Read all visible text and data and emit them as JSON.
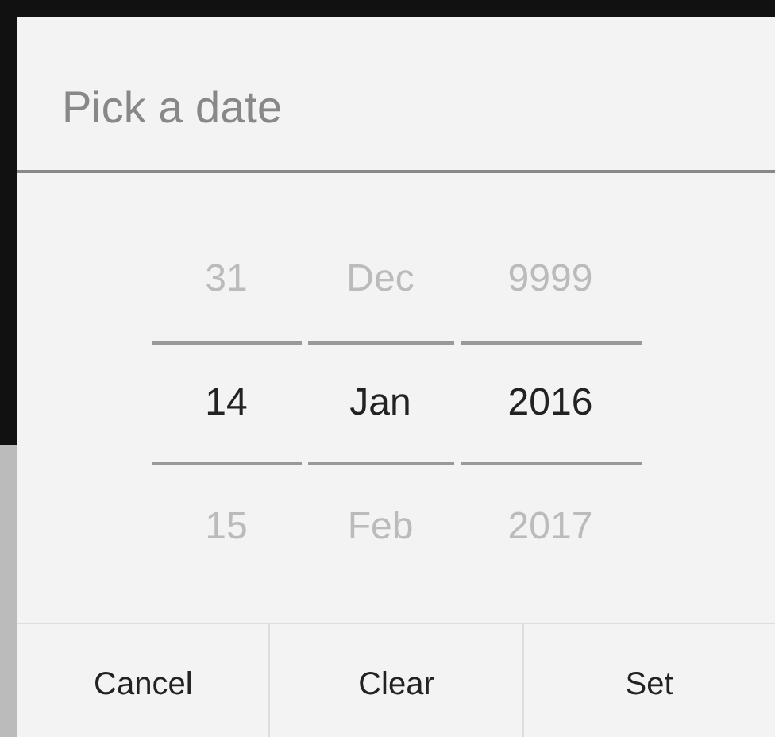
{
  "dialog": {
    "title": "Pick a date",
    "pickers": [
      {
        "items": [
          {
            "label": "31",
            "selected": false
          },
          {
            "label": "14",
            "selected": true
          },
          {
            "label": "15",
            "selected": false
          }
        ]
      },
      {
        "items": [
          {
            "label": "Dec",
            "selected": false
          },
          {
            "label": "Jan",
            "selected": true
          },
          {
            "label": "Feb",
            "selected": false
          }
        ]
      },
      {
        "items": [
          {
            "label": "9999",
            "selected": false
          },
          {
            "label": "2016",
            "selected": true
          },
          {
            "label": "2017",
            "selected": false
          }
        ]
      }
    ],
    "buttons": [
      "Cancel",
      "Clear",
      "Set"
    ]
  }
}
